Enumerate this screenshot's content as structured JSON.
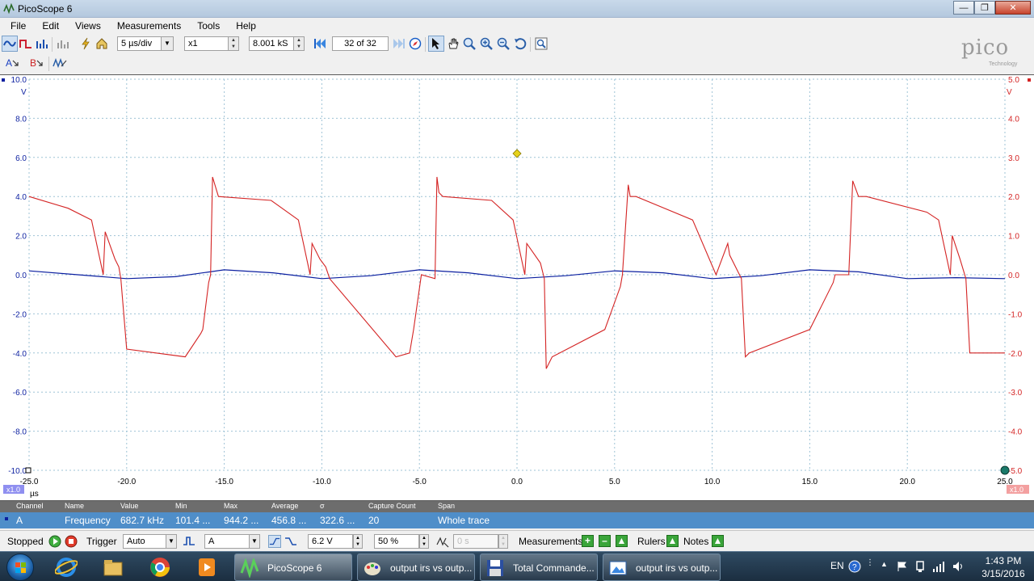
{
  "window": {
    "title": "PicoScope 6"
  },
  "menu": [
    "File",
    "Edit",
    "Views",
    "Measurements",
    "Tools",
    "Help"
  ],
  "toolbar": {
    "timebase": "5 µs/div",
    "zoom": "x1",
    "samples": "8.001 kS",
    "buffer": "32 of 32"
  },
  "logo": {
    "word": "pico",
    "sub": "Technology"
  },
  "channel_buttons": {
    "a": "A",
    "b": "B"
  },
  "scope": {
    "left_axis": {
      "unit": "V",
      "ticks": [
        "10.0",
        "8.0",
        "6.0",
        "4.0",
        "2.0",
        "0.0",
        "-2.0",
        "-4.0",
        "-6.0",
        "-8.0",
        "-10.0"
      ]
    },
    "right_axis": {
      "unit": "V",
      "ticks": [
        "5.0",
        "4.0",
        "3.0",
        "2.0",
        "1.0",
        "0.0",
        "-1.0",
        "-2.0",
        "-3.0",
        "-4.0",
        "-5.0"
      ]
    },
    "x_axis": {
      "unit": "µs",
      "ticks": [
        "-25.0",
        "-20.0",
        "-15.0",
        "-10.0",
        "-5.0",
        "0.0",
        "5.0",
        "10.0",
        "15.0",
        "20.0",
        "25.0"
      ]
    },
    "scale_left": "x1.0",
    "scale_right": "x1.0",
    "colors": {
      "channel_a": "#0b1fa0",
      "channel_b": "#d42424",
      "grid": "#9ec3d6",
      "trigger": "#e6d21a"
    }
  },
  "measurements": {
    "headers": [
      "Channel",
      "Name",
      "Value",
      "Min",
      "Max",
      "Average",
      "σ",
      "Capture Count",
      "Span"
    ],
    "row": [
      "A",
      "Frequency",
      "682.7 kHz",
      "101.4 ...",
      "944.2 ...",
      "456.8 ...",
      "322.6 ...",
      "20",
      "Whole trace"
    ]
  },
  "status": {
    "state": "Stopped",
    "trigger_label": "Trigger",
    "trigger_mode": "Auto",
    "trigger_channel": "A",
    "threshold": "6.2 V",
    "pretrigger": "50 %",
    "delay": "0 s",
    "measurements_label": "Measurements",
    "rulers_label": "Rulers",
    "notes_label": "Notes"
  },
  "taskbar": {
    "tasks": [
      "PicoScope 6",
      "output irs vs outp...",
      "Total Commande...",
      "output irs vs outp..."
    ],
    "lang": "EN",
    "time": "1:43 PM",
    "date": "3/15/2016"
  },
  "chart_data": {
    "type": "line",
    "x_unit": "µs",
    "xlim": [
      -25,
      25
    ],
    "series": [
      {
        "name": "A",
        "axis": "left",
        "ylim": [
          -10,
          10
        ],
        "x": [
          -25,
          -22.5,
          -20,
          -17.5,
          -15,
          -12.5,
          -10,
          -7.5,
          -5,
          -2.5,
          0,
          2.5,
          5,
          7.5,
          10,
          12.5,
          15,
          17.5,
          20,
          22.5,
          25
        ],
        "y": [
          0.2,
          0.0,
          -0.2,
          -0.1,
          0.25,
          0.1,
          -0.2,
          -0.05,
          0.25,
          0.1,
          -0.2,
          -0.05,
          0.2,
          0.1,
          -0.2,
          -0.05,
          0.25,
          0.15,
          -0.2,
          -0.15,
          -0.2
        ]
      },
      {
        "name": "B",
        "axis": "right",
        "ylim": [
          -5,
          5
        ],
        "x": [
          -25,
          -23,
          -21.8,
          -21.2,
          -21.1,
          -20.6,
          -20.4,
          -20.3,
          -20,
          -17,
          -16.2,
          -16.1,
          -15.8,
          -15.7,
          -15.6,
          -15.3,
          -12.6,
          -11.2,
          -10.6,
          -10.5,
          -10.1,
          -9.8,
          -9.6,
          -6.2,
          -5.5,
          -5.3,
          -4.9,
          -4.2,
          -4.1,
          -4.0,
          -3.8,
          -1.3,
          -0.2,
          0.4,
          0.5,
          1.2,
          1.4,
          1.5,
          1.8,
          4.5,
          5.3,
          5.4,
          5.7,
          5.8,
          6.1,
          9,
          10.2,
          10.8,
          10.9,
          11.5,
          11.7,
          11.9,
          15,
          16.2,
          16.3,
          16.6,
          17,
          17.2,
          17.5,
          17.9,
          21,
          21.6,
          22.2,
          22.3,
          22.7,
          23.0,
          23.2,
          25
        ],
        "y": [
          2.0,
          1.7,
          1.4,
          0.0,
          1.1,
          0.4,
          0.2,
          -0.1,
          -1.9,
          -2.1,
          -1.5,
          -1.4,
          -0.2,
          0.0,
          2.5,
          2.0,
          1.9,
          1.4,
          0.0,
          0.8,
          0.4,
          0.2,
          -0.1,
          -2.1,
          -2.0,
          -1.4,
          0.0,
          -0.1,
          2.5,
          2.1,
          2.0,
          1.9,
          1.4,
          0.0,
          0.8,
          0.3,
          -0.1,
          -2.4,
          -2.1,
          -1.4,
          -0.3,
          0.0,
          2.3,
          2.0,
          2.0,
          1.4,
          0.0,
          0.8,
          0.5,
          -0.1,
          -2.1,
          -2.0,
          -1.4,
          -0.2,
          0.0,
          0.0,
          0.0,
          2.4,
          2.0,
          2.0,
          1.6,
          1.4,
          0.0,
          1.0,
          0.4,
          -0.1,
          -2.0,
          -2.0
        ]
      }
    ],
    "trigger_marker": {
      "x": 0,
      "y_left": 6.2
    }
  }
}
